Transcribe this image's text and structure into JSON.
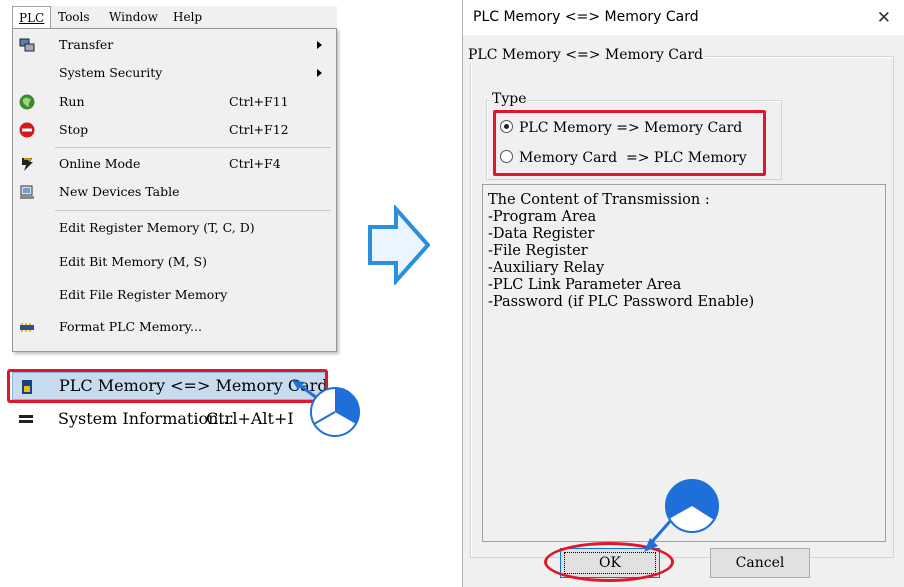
{
  "menubar": {
    "items": [
      {
        "label": "PLC",
        "active": true
      },
      {
        "label": "Tools"
      },
      {
        "label": "Window"
      },
      {
        "label": "Help"
      }
    ]
  },
  "menu": {
    "items": [
      {
        "label": "Transfer",
        "icon": "transfer-icon",
        "submenu": true
      },
      {
        "label": "System Security",
        "submenu": true
      },
      {
        "label": "Run",
        "shortcut": "Ctrl+F11",
        "icon": "run-icon"
      },
      {
        "label": "Stop",
        "shortcut": "Ctrl+F12",
        "icon": "stop-icon"
      },
      {
        "label": "Online Mode",
        "shortcut": "Ctrl+F4",
        "icon": "online-mode-icon"
      },
      {
        "label": "New Devices Table",
        "icon": "devices-table-icon"
      },
      {
        "label": "Edit Register Memory (T, C, D)"
      },
      {
        "label": "Edit Bit Memory (M, S)"
      },
      {
        "label": "Edit File Register Memory"
      },
      {
        "label": "Format PLC Memory...",
        "icon": "format-memory-icon"
      },
      {
        "label": "PLC Memory <=> Memory Card...",
        "icon": "memory-card-icon",
        "selected": true
      },
      {
        "label": "System Information...",
        "shortcut": "Ctrl+Alt+I",
        "icon": "system-info-icon"
      }
    ]
  },
  "dialog": {
    "title": "PLC Memory <=> Memory Card",
    "group_label": "PLC Memory <=> Memory Card",
    "type_label": "Type",
    "options": [
      {
        "label": "PLC Memory => Memory Card",
        "checked": true
      },
      {
        "label": "Memory Card  => PLC Memory",
        "checked": false
      }
    ],
    "content_lines": [
      "The Content of Transmission :",
      "-Program Area",
      "-Data Register",
      "-File Register",
      "-Auxiliary Relay",
      "-PLC Link Parameter Area",
      "-Password (if PLC Password Enable)"
    ],
    "ok_label": "OK",
    "cancel_label": "Cancel"
  },
  "colors": {
    "highlight_red": "#e0172a",
    "callout_blue": "#1e6fd9",
    "arrow_blue": "#2a8fdc"
  }
}
